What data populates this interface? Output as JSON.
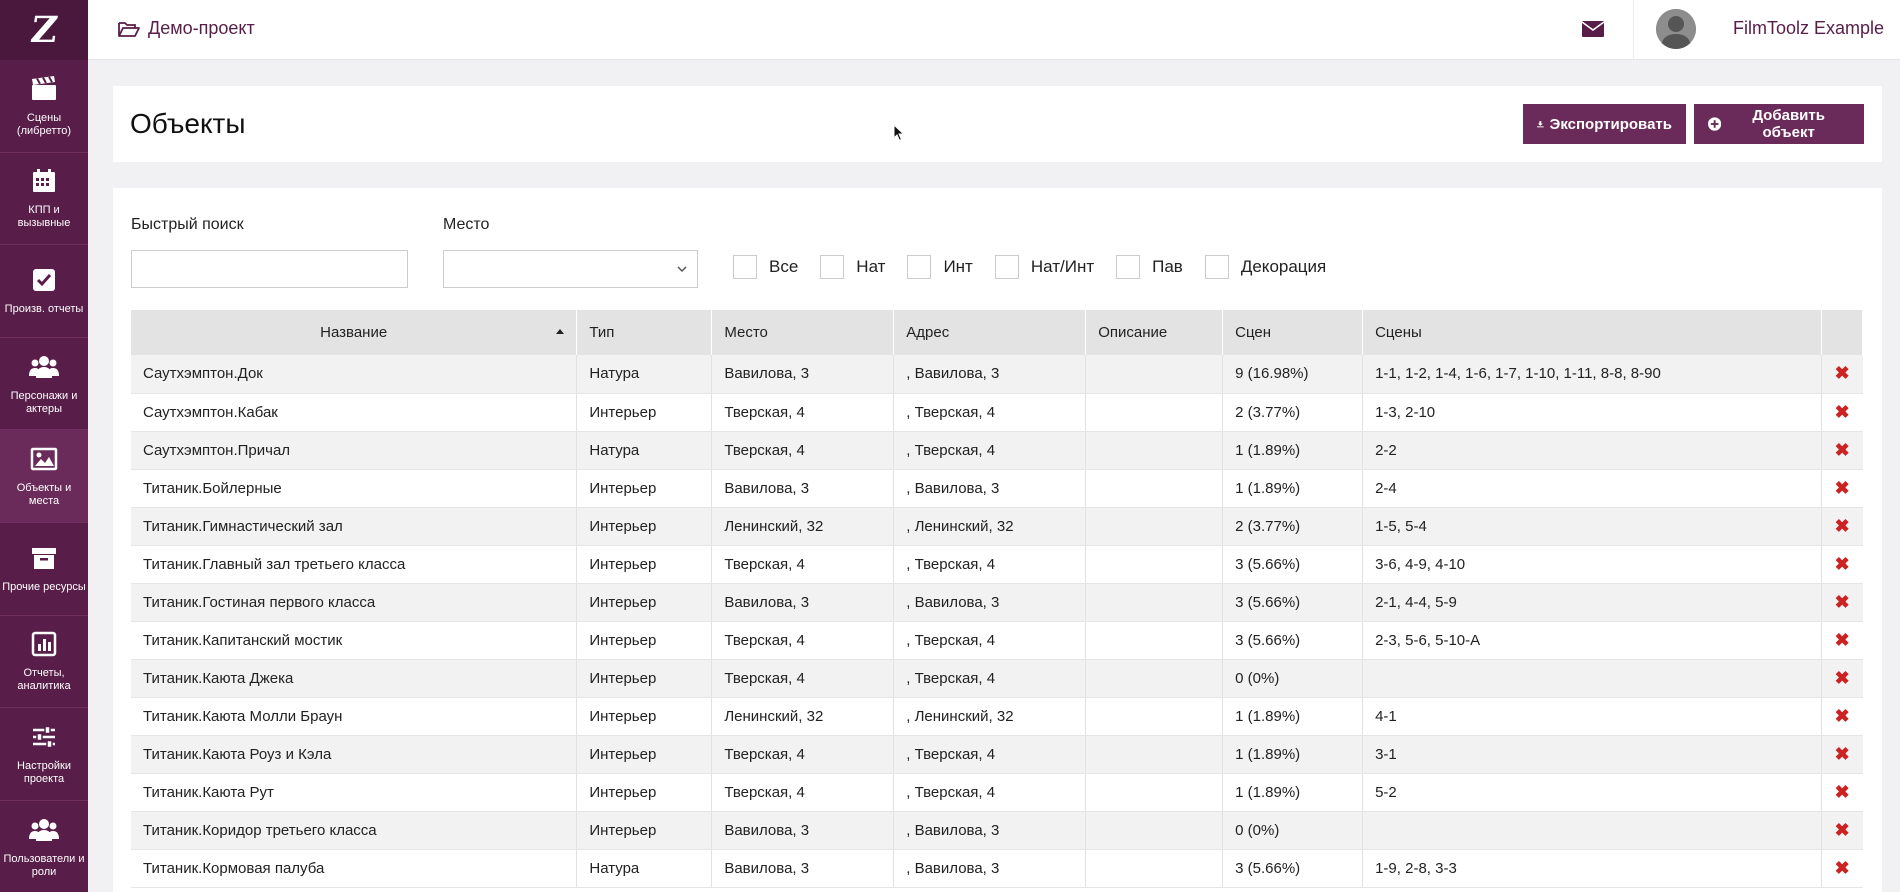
{
  "brand": {
    "logo_letter": "Z"
  },
  "sidebar": {
    "items": [
      {
        "label": "Сцены (либретто)",
        "icon": "clapperboard-icon"
      },
      {
        "label": "КПП и вызывные",
        "icon": "calendar-icon"
      },
      {
        "label": "Произв. отчеты",
        "icon": "checkbox-icon"
      },
      {
        "label": "Персонажи и актеры",
        "icon": "users-icon"
      },
      {
        "label": "Объекты и места",
        "icon": "image-icon"
      },
      {
        "label": "Прочие ресурсы",
        "icon": "archive-icon"
      },
      {
        "label": "Отчеты, аналитика",
        "icon": "bar-chart-icon"
      },
      {
        "label": "Настройки проекта",
        "icon": "sliders-icon"
      },
      {
        "label": "Пользователи и роли",
        "icon": "users-icon"
      }
    ]
  },
  "topbar": {
    "project_name": "Демо-проект",
    "user_name": "FilmToolz Example"
  },
  "header": {
    "title": "Объекты",
    "export_label": "Экспортировать",
    "add_label": "Добавить объект"
  },
  "filters": {
    "search_label": "Быстрый поиск",
    "search_value": "",
    "place_label": "Место",
    "place_value": "",
    "checkboxes": [
      "Все",
      "Нат",
      "Инт",
      "Нат/Инт",
      "Пав",
      "Декорация"
    ]
  },
  "table": {
    "columns": [
      "Название",
      "Тип",
      "Место",
      "Адрес",
      "Описание",
      "Сцен",
      "Сцены"
    ],
    "rows": [
      [
        "Саутхэмптон.Док",
        "Натура",
        "Вавилова, 3",
        ", Вавилова, 3",
        "",
        "9 (16.98%)",
        "1-1, 1-2, 1-4, 1-6, 1-7, 1-10, 1-11, 8-8, 8-90"
      ],
      [
        "Саутхэмптон.Кабак",
        "Интерьер",
        "Тверская, 4",
        ", Тверская, 4",
        "",
        "2 (3.77%)",
        "1-3, 2-10"
      ],
      [
        "Саутхэмптон.Причал",
        "Натура",
        "Тверская, 4",
        ", Тверская, 4",
        "",
        "1 (1.89%)",
        "2-2"
      ],
      [
        "Титаник.Бойлерные",
        "Интерьер",
        "Вавилова, 3",
        ", Вавилова, 3",
        "",
        "1 (1.89%)",
        "2-4"
      ],
      [
        "Титаник.Гимнастический зал",
        "Интерьер",
        "Ленинский, 32",
        ", Ленинский, 32",
        "",
        "2 (3.77%)",
        "1-5, 5-4"
      ],
      [
        "Титаник.Главный зал третьего класса",
        "Интерьер",
        "Тверская, 4",
        ", Тверская, 4",
        "",
        "3 (5.66%)",
        "3-6, 4-9, 4-10"
      ],
      [
        "Титаник.Гостиная первого класса",
        "Интерьер",
        "Вавилова, 3",
        ", Вавилова, 3",
        "",
        "3 (5.66%)",
        "2-1, 4-4, 5-9"
      ],
      [
        "Титаник.Капитанский мостик",
        "Интерьер",
        "Тверская, 4",
        ", Тверская, 4",
        "",
        "3 (5.66%)",
        "2-3, 5-6, 5-10-А"
      ],
      [
        "Титаник.Каюта Джека",
        "Интерьер",
        "Тверская, 4",
        ", Тверская, 4",
        "",
        "0 (0%)",
        ""
      ],
      [
        "Титаник.Каюта Молли Браун",
        "Интерьер",
        "Ленинский, 32",
        ", Ленинский, 32",
        "",
        "1 (1.89%)",
        "4-1"
      ],
      [
        "Титаник.Каюта Роуз и Кэла",
        "Интерьер",
        "Тверская, 4",
        ", Тверская, 4",
        "",
        "1 (1.89%)",
        "3-1"
      ],
      [
        "Титаник.Каюта Рут",
        "Интерьер",
        "Тверская, 4",
        ", Тверская, 4",
        "",
        "1 (1.89%)",
        "5-2"
      ],
      [
        "Титаник.Коридор третьего класса",
        "Интерьер",
        "Вавилова, 3",
        ", Вавилова, 3",
        "",
        "0 (0%)",
        ""
      ],
      [
        "Титаник.Кормовая палуба",
        "Натура",
        "Вавилова, 3",
        ", Вавилова, 3",
        "",
        "3 (5.66%)",
        "1-9, 2-8, 3-3"
      ]
    ]
  }
}
